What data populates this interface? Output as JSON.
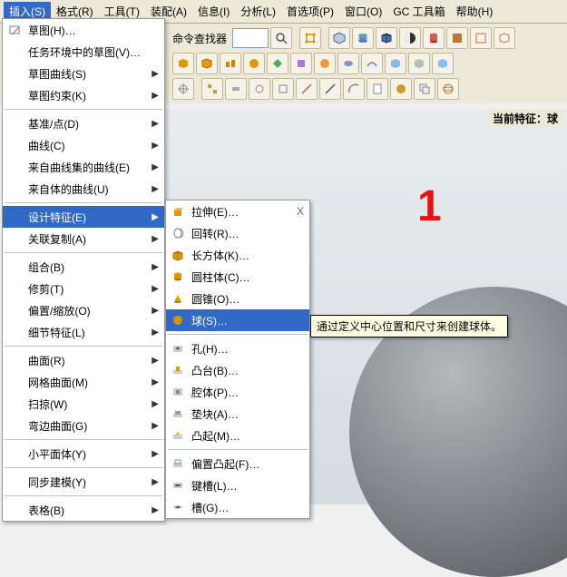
{
  "menubar": {
    "items": [
      {
        "label": "插入(S)",
        "active": true
      },
      {
        "label": "格式(R)"
      },
      {
        "label": "工具(T)"
      },
      {
        "label": "装配(A)"
      },
      {
        "label": "信息(I)"
      },
      {
        "label": "分析(L)"
      },
      {
        "label": "首选项(P)"
      },
      {
        "label": "窗口(O)"
      },
      {
        "label": "GC 工具箱"
      },
      {
        "label": "帮助(H)"
      }
    ]
  },
  "toolbar": {
    "command_finder_label": "命令查找器"
  },
  "status": {
    "current_feature_label": "当前特征：",
    "current_feature_value": "球"
  },
  "annotation": {
    "number": "1"
  },
  "insert_menu": {
    "items": [
      {
        "label": "草图(H)…",
        "icon": "sketch"
      },
      {
        "label": "任务环境中的草图(V)…"
      },
      {
        "label": "草图曲线(S)",
        "arrow": true
      },
      {
        "label": "草图约束(K)",
        "arrow": true
      },
      {
        "sep": true
      },
      {
        "label": "基准/点(D)",
        "arrow": true
      },
      {
        "label": "曲线(C)",
        "arrow": true
      },
      {
        "label": "来自曲线集的曲线(E)",
        "arrow": true
      },
      {
        "label": "来自体的曲线(U)",
        "arrow": true
      },
      {
        "sep": true
      },
      {
        "label": "设计特征(E)",
        "arrow": true,
        "hover": true
      },
      {
        "label": "关联复制(A)",
        "arrow": true
      },
      {
        "sep": true
      },
      {
        "label": "组合(B)",
        "arrow": true
      },
      {
        "label": "修剪(T)",
        "arrow": true
      },
      {
        "label": "偏置/缩放(O)",
        "arrow": true
      },
      {
        "label": "细节特征(L)",
        "arrow": true
      },
      {
        "sep": true
      },
      {
        "label": "曲面(R)",
        "arrow": true
      },
      {
        "label": "网格曲面(M)",
        "arrow": true
      },
      {
        "label": "扫掠(W)",
        "arrow": true
      },
      {
        "label": "弯边曲面(G)",
        "arrow": true
      },
      {
        "sep": true
      },
      {
        "label": "小平面体(Y)",
        "arrow": true
      },
      {
        "sep": true
      },
      {
        "label": "同步建模(Y)",
        "arrow": true
      },
      {
        "sep": true
      },
      {
        "label": "表格(B)",
        "arrow": true
      }
    ]
  },
  "feature_submenu": {
    "items": [
      {
        "label": "拉伸(E)…",
        "accel": "X",
        "icon": "extrude"
      },
      {
        "label": "回转(R)…",
        "icon": "revolve"
      },
      {
        "label": "长方体(K)…",
        "icon": "block"
      },
      {
        "label": "圆柱体(C)…",
        "icon": "cylinder"
      },
      {
        "label": "圆锥(O)…",
        "icon": "cone"
      },
      {
        "label": "球(S)…",
        "icon": "sphere",
        "hover": true
      },
      {
        "sep": true
      },
      {
        "label": "孔(H)…",
        "icon": "hole"
      },
      {
        "label": "凸台(B)…",
        "icon": "boss"
      },
      {
        "label": "腔体(P)…",
        "icon": "pocket"
      },
      {
        "label": "垫块(A)…",
        "icon": "pad"
      },
      {
        "label": "凸起(M)…",
        "icon": "emboss"
      },
      {
        "sep": true
      },
      {
        "label": "偏置凸起(F)…",
        "icon": "offset"
      },
      {
        "label": "键槽(L)…",
        "icon": "slot"
      },
      {
        "label": "槽(G)…",
        "icon": "groove"
      }
    ]
  },
  "tooltip": {
    "text": "通过定义中心位置和尺寸来创建球体。"
  }
}
